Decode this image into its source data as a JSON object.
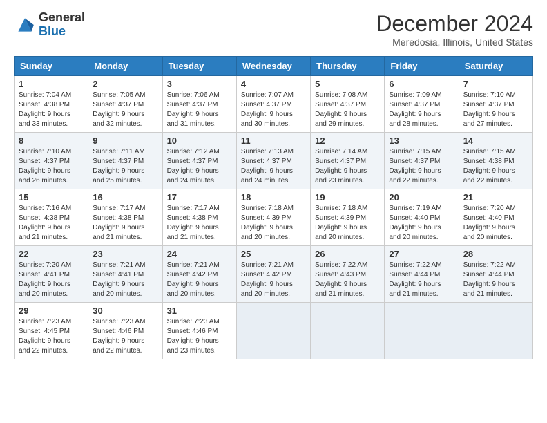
{
  "header": {
    "logo_line1": "General",
    "logo_line2": "Blue",
    "month_title": "December 2024",
    "location": "Meredosia, Illinois, United States"
  },
  "columns": [
    "Sunday",
    "Monday",
    "Tuesday",
    "Wednesday",
    "Thursday",
    "Friday",
    "Saturday"
  ],
  "weeks": [
    [
      {
        "day": "1",
        "rise": "Sunrise: 7:04 AM",
        "set": "Sunset: 4:38 PM",
        "daylight": "Daylight: 9 hours and 33 minutes."
      },
      {
        "day": "2",
        "rise": "Sunrise: 7:05 AM",
        "set": "Sunset: 4:37 PM",
        "daylight": "Daylight: 9 hours and 32 minutes."
      },
      {
        "day": "3",
        "rise": "Sunrise: 7:06 AM",
        "set": "Sunset: 4:37 PM",
        "daylight": "Daylight: 9 hours and 31 minutes."
      },
      {
        "day": "4",
        "rise": "Sunrise: 7:07 AM",
        "set": "Sunset: 4:37 PM",
        "daylight": "Daylight: 9 hours and 30 minutes."
      },
      {
        "day": "5",
        "rise": "Sunrise: 7:08 AM",
        "set": "Sunset: 4:37 PM",
        "daylight": "Daylight: 9 hours and 29 minutes."
      },
      {
        "day": "6",
        "rise": "Sunrise: 7:09 AM",
        "set": "Sunset: 4:37 PM",
        "daylight": "Daylight: 9 hours and 28 minutes."
      },
      {
        "day": "7",
        "rise": "Sunrise: 7:10 AM",
        "set": "Sunset: 4:37 PM",
        "daylight": "Daylight: 9 hours and 27 minutes."
      }
    ],
    [
      {
        "day": "8",
        "rise": "Sunrise: 7:10 AM",
        "set": "Sunset: 4:37 PM",
        "daylight": "Daylight: 9 hours and 26 minutes."
      },
      {
        "day": "9",
        "rise": "Sunrise: 7:11 AM",
        "set": "Sunset: 4:37 PM",
        "daylight": "Daylight: 9 hours and 25 minutes."
      },
      {
        "day": "10",
        "rise": "Sunrise: 7:12 AM",
        "set": "Sunset: 4:37 PM",
        "daylight": "Daylight: 9 hours and 24 minutes."
      },
      {
        "day": "11",
        "rise": "Sunrise: 7:13 AM",
        "set": "Sunset: 4:37 PM",
        "daylight": "Daylight: 9 hours and 24 minutes."
      },
      {
        "day": "12",
        "rise": "Sunrise: 7:14 AM",
        "set": "Sunset: 4:37 PM",
        "daylight": "Daylight: 9 hours and 23 minutes."
      },
      {
        "day": "13",
        "rise": "Sunrise: 7:15 AM",
        "set": "Sunset: 4:37 PM",
        "daylight": "Daylight: 9 hours and 22 minutes."
      },
      {
        "day": "14",
        "rise": "Sunrise: 7:15 AM",
        "set": "Sunset: 4:38 PM",
        "daylight": "Daylight: 9 hours and 22 minutes."
      }
    ],
    [
      {
        "day": "15",
        "rise": "Sunrise: 7:16 AM",
        "set": "Sunset: 4:38 PM",
        "daylight": "Daylight: 9 hours and 21 minutes."
      },
      {
        "day": "16",
        "rise": "Sunrise: 7:17 AM",
        "set": "Sunset: 4:38 PM",
        "daylight": "Daylight: 9 hours and 21 minutes."
      },
      {
        "day": "17",
        "rise": "Sunrise: 7:17 AM",
        "set": "Sunset: 4:38 PM",
        "daylight": "Daylight: 9 hours and 21 minutes."
      },
      {
        "day": "18",
        "rise": "Sunrise: 7:18 AM",
        "set": "Sunset: 4:39 PM",
        "daylight": "Daylight: 9 hours and 20 minutes."
      },
      {
        "day": "19",
        "rise": "Sunrise: 7:18 AM",
        "set": "Sunset: 4:39 PM",
        "daylight": "Daylight: 9 hours and 20 minutes."
      },
      {
        "day": "20",
        "rise": "Sunrise: 7:19 AM",
        "set": "Sunset: 4:40 PM",
        "daylight": "Daylight: 9 hours and 20 minutes."
      },
      {
        "day": "21",
        "rise": "Sunrise: 7:20 AM",
        "set": "Sunset: 4:40 PM",
        "daylight": "Daylight: 9 hours and 20 minutes."
      }
    ],
    [
      {
        "day": "22",
        "rise": "Sunrise: 7:20 AM",
        "set": "Sunset: 4:41 PM",
        "daylight": "Daylight: 9 hours and 20 minutes."
      },
      {
        "day": "23",
        "rise": "Sunrise: 7:21 AM",
        "set": "Sunset: 4:41 PM",
        "daylight": "Daylight: 9 hours and 20 minutes."
      },
      {
        "day": "24",
        "rise": "Sunrise: 7:21 AM",
        "set": "Sunset: 4:42 PM",
        "daylight": "Daylight: 9 hours and 20 minutes."
      },
      {
        "day": "25",
        "rise": "Sunrise: 7:21 AM",
        "set": "Sunset: 4:42 PM",
        "daylight": "Daylight: 9 hours and 20 minutes."
      },
      {
        "day": "26",
        "rise": "Sunrise: 7:22 AM",
        "set": "Sunset: 4:43 PM",
        "daylight": "Daylight: 9 hours and 21 minutes."
      },
      {
        "day": "27",
        "rise": "Sunrise: 7:22 AM",
        "set": "Sunset: 4:44 PM",
        "daylight": "Daylight: 9 hours and 21 minutes."
      },
      {
        "day": "28",
        "rise": "Sunrise: 7:22 AM",
        "set": "Sunset: 4:44 PM",
        "daylight": "Daylight: 9 hours and 21 minutes."
      }
    ],
    [
      {
        "day": "29",
        "rise": "Sunrise: 7:23 AM",
        "set": "Sunset: 4:45 PM",
        "daylight": "Daylight: 9 hours and 22 minutes."
      },
      {
        "day": "30",
        "rise": "Sunrise: 7:23 AM",
        "set": "Sunset: 4:46 PM",
        "daylight": "Daylight: 9 hours and 22 minutes."
      },
      {
        "day": "31",
        "rise": "Sunrise: 7:23 AM",
        "set": "Sunset: 4:46 PM",
        "daylight": "Daylight: 9 hours and 23 minutes."
      },
      null,
      null,
      null,
      null
    ]
  ]
}
